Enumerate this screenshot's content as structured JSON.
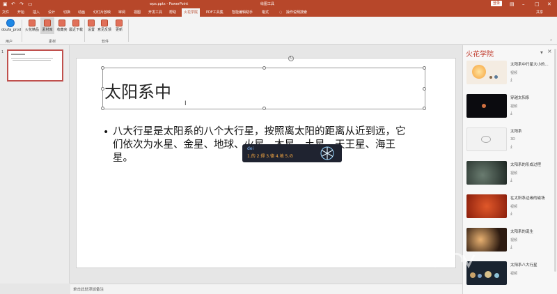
{
  "window": {
    "title": "wps.pptx - PowerPoint",
    "context_tool": "绘图工具",
    "login_label": "登录",
    "qat_icons": [
      "save-icon",
      "undo-icon",
      "redo-icon",
      "present-icon"
    ]
  },
  "tabs": [
    "文件",
    "开始",
    "插入",
    "设计",
    "切换",
    "动画",
    "幻灯片放映",
    "审阅",
    "视图",
    "开发工具",
    "帮助",
    "火花学院",
    "PDF工具集",
    "智能编辑助手",
    "格式"
  ],
  "active_tab": "火花学院",
  "tell_me": "操作说明搜索",
  "share": "共享",
  "ribbon": {
    "user": {
      "name": "doufa_prod",
      "group": "用户"
    },
    "material": {
      "buttons": [
        "火花精品",
        "素材库",
        "收藏夹",
        "最近下载"
      ],
      "group": "素材"
    },
    "software": {
      "buttons": [
        "设置",
        "意见反馈",
        "更新"
      ],
      "group": "软件"
    }
  },
  "slide_number": "1",
  "slide": {
    "title": "太阳系中",
    "body": "八大行星是太阳系的八个大行星，按照离太阳的距离从近到远，它们依次为水星、金星、地球、火星、木星、土星、天王星、海王星。"
  },
  "ime": {
    "composition": "dei",
    "candidates": "1.的  2.得  3.德  4.地  5.の"
  },
  "notes_placeholder": "单击此处添加备注",
  "sidepane": {
    "title": "火花学院",
    "items": [
      {
        "name": "太阳系中行星大小的...",
        "type": "视频",
        "color": "#f1d9b8"
      },
      {
        "name": "穿越太阳系",
        "type": "视频",
        "color": "#0b0b0f"
      },
      {
        "name": "太阳系",
        "type": "3D",
        "color": "#f2f2f2"
      },
      {
        "name": "太阳系的形成过程",
        "type": "视频",
        "color": "#2a3a36"
      },
      {
        "name": "在太阳系边缘的磁场",
        "type": "视频",
        "color": "#b03a14"
      },
      {
        "name": "太阳系的诞生",
        "type": "视频",
        "color": "#2c1a10"
      },
      {
        "name": "太阳系八大行星",
        "type": "视频",
        "color": "#1a2430"
      }
    ]
  }
}
